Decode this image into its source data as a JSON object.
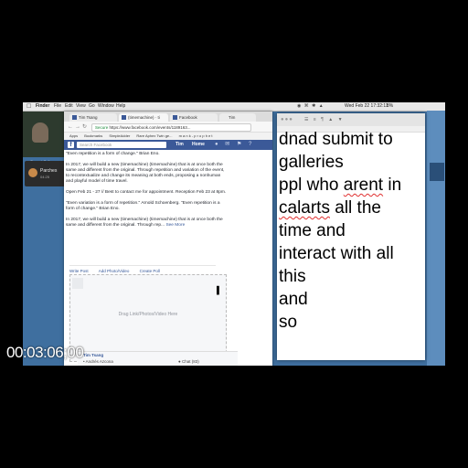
{
  "menubar": {
    "app": "Finder",
    "items": [
      "File",
      "Edit",
      "View",
      "Go",
      "Window",
      "Help"
    ],
    "clock": "Wed Feb 22  17:32:11",
    "battery": "8%"
  },
  "webcam": {
    "label": "Current Call"
  },
  "call": {
    "name": "Parches",
    "time": "04:25"
  },
  "browser": {
    "tabs": [
      "Tim Tsang",
      "(timemachine) · ti",
      "Facebook",
      "Tim"
    ],
    "url": "https://www.facebook.com/events/1189163...",
    "secure_label": "Secure",
    "bookmarks": [
      "Apps",
      "Bookmarks",
      "SimpleAdder",
      "Rare Aphex Twin ge...",
      "m a n k - p r o p h e t"
    ],
    "fb_search_placeholder": "Search Facebook",
    "fb_user": "Tim",
    "fb_home": "Home"
  },
  "post": {
    "p1": "\"Even repetition is a form of change.\" Brian Eno.",
    "p2": "In 2017, we will build a new (timemachine) (timemachine) that is at once both the same and different from the original. Through repetition and variation of the event, to recontextualize and change its meaning at both ends, proposing a nonhuman and playful model of time travel.",
    "p3": "Open Feb 21 - 27 // Best to contact me for appointment. Reception Feb 23 at 8pm.",
    "p4": "\"Even variation is a form of repetition.\" Arnold Schoenberg. \"Even repetition is a form of change.\" Brian Eno.",
    "p5": "In 2017, we will build a new (timemachine) (timemachine) that is at once both the same and different from the original. Through rep...",
    "see_more": "See More",
    "actions": [
      "Write Post",
      "Add Photo/Video",
      "Create Poll"
    ],
    "dropzone": "Drag Link/Photos/Video Here"
  },
  "chat": {
    "person1": "Tim Tsang",
    "person2": "• Andrés Azcona",
    "label": "● Chat (83)"
  },
  "notes": {
    "line1": "dnad submit to",
    "line2": "galleries",
    "line3a": "ppl who ",
    "line3b": "arent",
    "line3c": " in",
    "line4a": "calarts",
    "line4b": " all the",
    "line5": "time and",
    "line6": "interact with all",
    "line7": "this",
    "line8": "and",
    "line9": "so"
  },
  "timecode": "00:03:06;00",
  "colors": {
    "facebook_blue": "#3b5998",
    "end_call_red": "#d8332d",
    "desktop_blue": "#3f6f9f"
  }
}
